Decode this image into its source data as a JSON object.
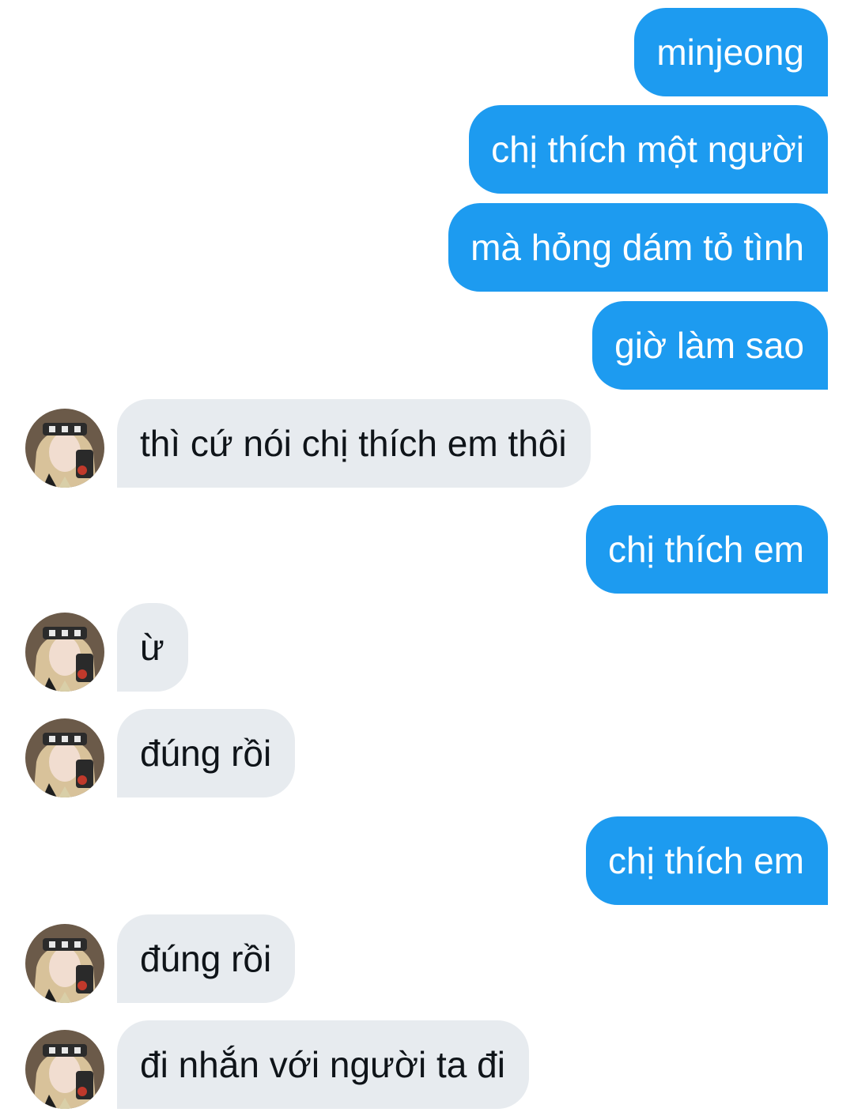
{
  "messages": [
    {
      "from": "me",
      "text": "minjeong"
    },
    {
      "from": "me",
      "text": "chị thích một người"
    },
    {
      "from": "me",
      "text": "mà hỏng dám tỏ tình"
    },
    {
      "from": "me",
      "text": "giờ làm sao"
    },
    {
      "from": "them",
      "text": "thì cứ nói chị thích em thôi"
    },
    {
      "from": "me",
      "text": "chị thích em"
    },
    {
      "from": "them",
      "text": "ừ"
    },
    {
      "from": "them",
      "text": "đúng rồi"
    },
    {
      "from": "me",
      "text": "chị thích em"
    },
    {
      "from": "them",
      "text": "đúng rồi"
    },
    {
      "from": "them",
      "text": "đi nhắn với người ta đi"
    }
  ],
  "colors": {
    "outgoing_bubble": "#1d9bf0",
    "incoming_bubble": "#e7ebef",
    "outgoing_text": "#ffffff",
    "incoming_text": "#0f1419"
  },
  "icons": {
    "avatar": "contact-avatar-photo"
  }
}
